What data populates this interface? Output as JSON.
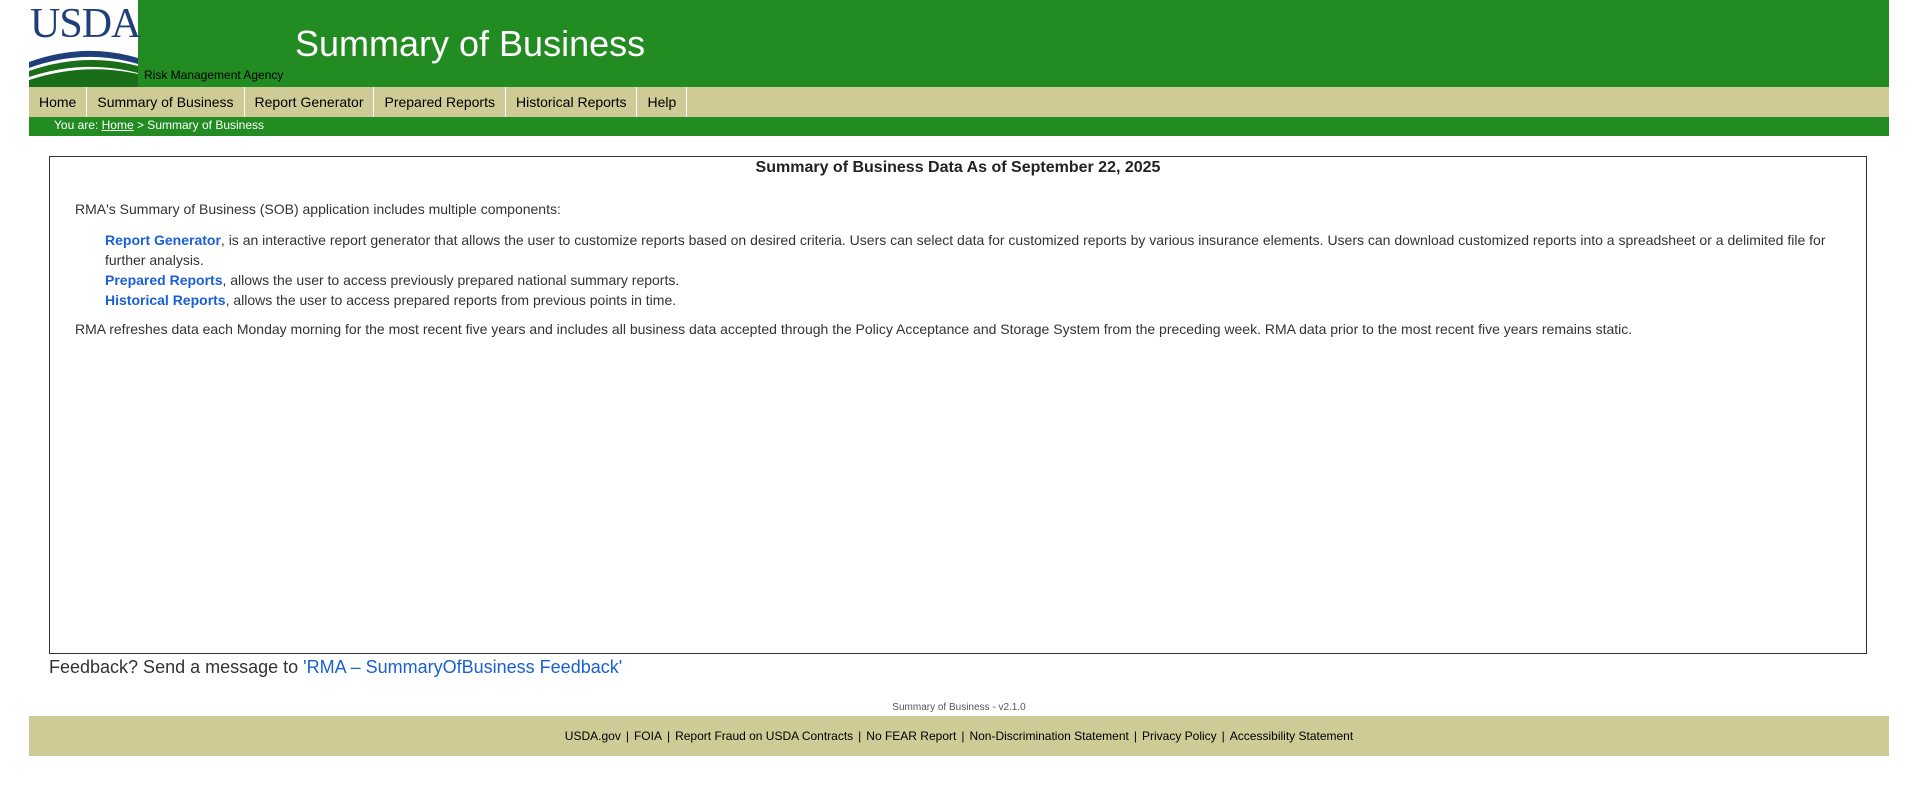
{
  "header": {
    "logo_text": "USDA",
    "agency": "Risk Management Agency",
    "app_title": "Summary of Business"
  },
  "nav": {
    "items": [
      "Home",
      "Summary of Business",
      "Report Generator",
      "Prepared Reports",
      "Historical Reports",
      "Help"
    ]
  },
  "breadcrumb": {
    "prefix": "You are:",
    "home": "Home",
    "current": "> Summary of Business"
  },
  "main": {
    "title": "Summary of Business Data As of September 22, 2025",
    "intro": "RMA's Summary of Business (SOB) application includes multiple components:",
    "components": [
      {
        "link": "Report Generator",
        "text": ", is an interactive report generator that allows the user to customize reports based on desired criteria. Users can select data for customized reports by various insurance elements. Users can download customized reports into a spreadsheet or a delimited file for further analysis."
      },
      {
        "link": "Prepared Reports",
        "text": ", allows the user to access previously prepared national summary reports."
      },
      {
        "link": "Historical Reports",
        "text": ", allows the user to access prepared reports from previous points in time."
      }
    ],
    "refresh": "RMA refreshes data each Monday morning for the most recent five years and includes all business data accepted through the Policy Acceptance and Storage System from the preceding week. RMA data prior to the most recent five years remains static."
  },
  "feedback": {
    "prefix": "Feedback? Send a message to ",
    "link": "'RMA – SummaryOfBusiness Feedback'"
  },
  "version": "Summary of Business - v2.1.0",
  "footer": {
    "links": [
      "USDA.gov",
      "FOIA",
      "Report Fraud on USDA Contracts",
      "No FEAR Report",
      "Non-Discrimination Statement",
      "Privacy Policy",
      "Accessibility Statement"
    ]
  },
  "colors": {
    "header_green": "#228b22",
    "nav_tan": "#cfcb96",
    "link_blue": "#1a5fd6",
    "logo_navy": "#1f3f7a"
  }
}
